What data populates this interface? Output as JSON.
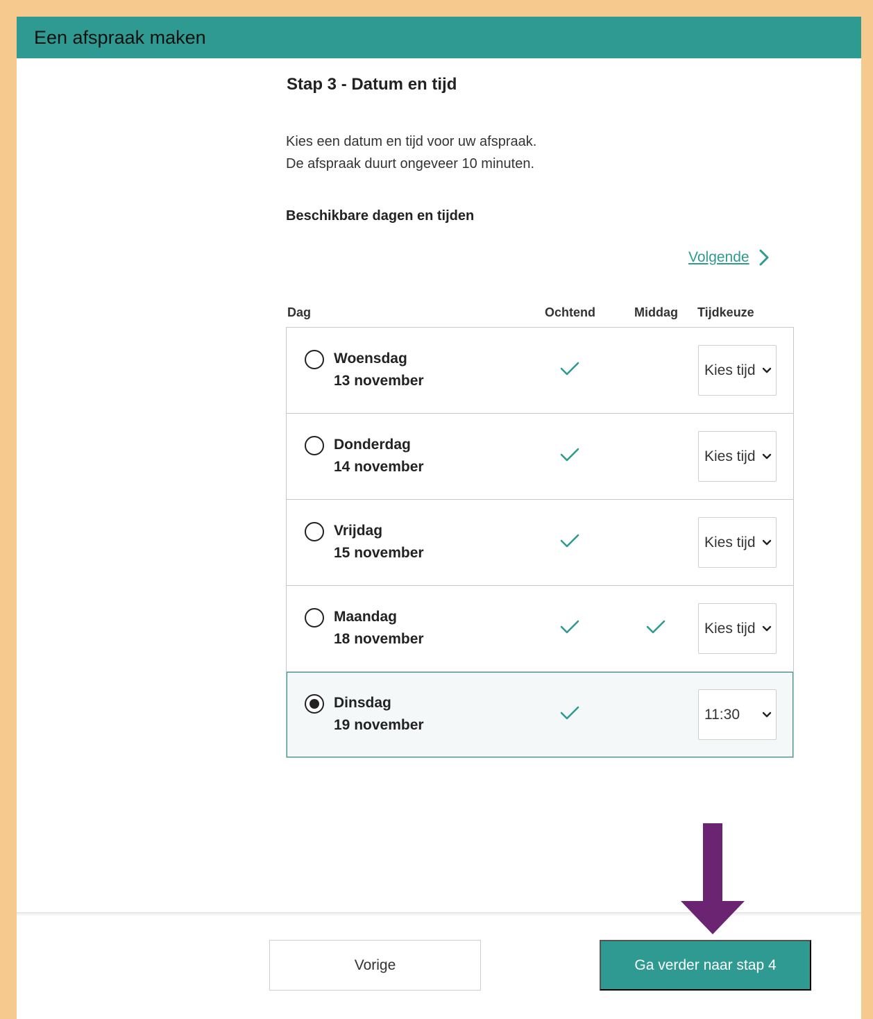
{
  "header": {
    "title": "Een afspraak maken"
  },
  "step": {
    "title": "Stap 3 - Datum en tijd",
    "intro_line1": "Kies een datum en tijd voor uw afspraak.",
    "intro_line2": "De afspraak duurt ongeveer 10 minuten.",
    "section_title": "Beschikbare dagen en tijden",
    "next_link": "Volgende"
  },
  "table": {
    "columns": {
      "day": "Dag",
      "morning": "Ochtend",
      "afternoon": "Middag",
      "time": "Tijdkeuze"
    },
    "rows": [
      {
        "day": "Woensdag",
        "date": "13 november",
        "morning": true,
        "afternoon": false,
        "time": "Kies tijd",
        "selected": false
      },
      {
        "day": "Donderdag",
        "date": "14 november",
        "morning": true,
        "afternoon": false,
        "time": "Kies tijd",
        "selected": false
      },
      {
        "day": "Vrijdag",
        "date": "15 november",
        "morning": true,
        "afternoon": false,
        "time": "Kies tijd",
        "selected": false
      },
      {
        "day": "Maandag",
        "date": "18 november",
        "morning": true,
        "afternoon": true,
        "time": "Kies tijd",
        "selected": false
      },
      {
        "day": "Dinsdag",
        "date": "19 november",
        "morning": true,
        "afternoon": false,
        "time": "11:30",
        "selected": true
      }
    ]
  },
  "footer": {
    "prev_label": "Vorige",
    "next_label": "Ga verder naar stap 4"
  },
  "icons": {
    "check": "check-icon",
    "chevron_right": "chevron-right-icon",
    "chevron_down": "chevron-down-icon",
    "arrow": "arrow-down-icon"
  },
  "colors": {
    "accent": "#2e9a91",
    "frame": "#f6c98e",
    "annotation_arrow": "#6b2472"
  }
}
